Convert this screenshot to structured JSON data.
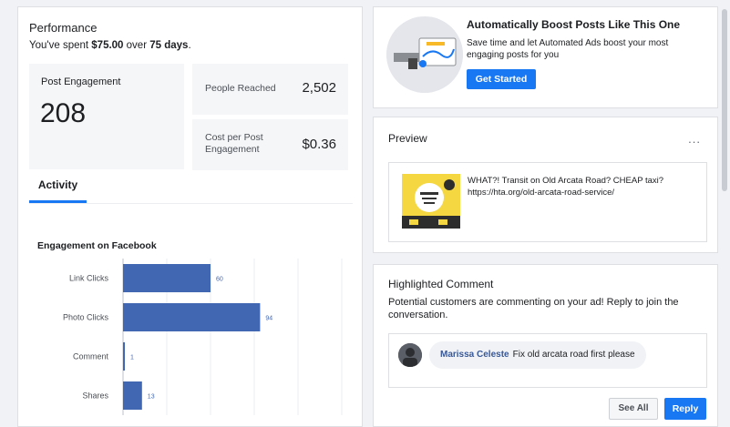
{
  "performance": {
    "title": "Performance",
    "spent_prefix": "You've spent ",
    "spent_amount": "$75.00",
    "spent_mid": " over ",
    "spent_days": "75 days",
    "spent_suffix": ".",
    "post_engagement_label": "Post Engagement",
    "post_engagement_value": "208",
    "people_reached_label": "People Reached",
    "people_reached_value": "2,502",
    "cost_label": "Cost per Post Engagement",
    "cost_value": "$0.36",
    "tab_activity": "Activity",
    "chart_title": "Engagement on Facebook"
  },
  "chart_data": {
    "type": "bar",
    "orientation": "horizontal",
    "title": "Engagement on Facebook",
    "categories": [
      "Link Clicks",
      "Photo Clicks",
      "Comment",
      "Shares"
    ],
    "values": [
      60,
      94,
      1,
      13
    ],
    "value_labels": [
      "60",
      "94",
      "1",
      "13"
    ],
    "xlim": [
      0,
      150
    ],
    "grid": true,
    "bar_color": "#4267b2"
  },
  "boost": {
    "title": "Automatically Boost Posts Like This One",
    "description": "Save time and let Automated Ads boost your most engaging posts for you",
    "button": "Get Started"
  },
  "preview": {
    "title": "Preview",
    "more": "...",
    "post_text": "WHAT?! Transit on Old Arcata Road? CHEAP taxi? https://hta.org/old-arcata-road-service/"
  },
  "highlighted_comment": {
    "title": "Highlighted Comment",
    "description": "Potential customers are commenting on your ad! Reply to join the conversation.",
    "author": "Marissa Celeste",
    "comment": "Fix old arcata road first please",
    "see_all": "See All",
    "reply": "Reply"
  },
  "colors": {
    "accent": "#1877f2",
    "bar": "#4267b2",
    "link": "#385898"
  }
}
